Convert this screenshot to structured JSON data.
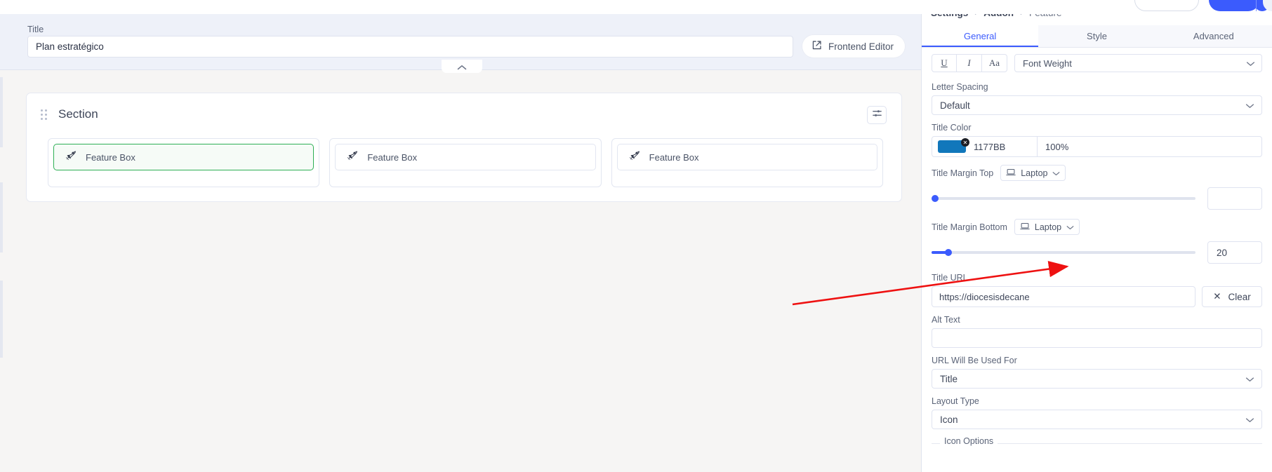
{
  "topbar": {
    "search_value": "",
    "primary_label": "",
    "avatar_label": ""
  },
  "canvas": {
    "title_label": "Title",
    "title_value": "Plan estratégico",
    "frontend_editor_label": "Frontend Editor",
    "frontend_editor_icon": "external-link-icon",
    "collapse_icon": "chevron-up-icon",
    "section": {
      "name": "Section",
      "drag_icon": "drag-handle-icon",
      "tool_icon": "section-settings-icon",
      "boxes": [
        {
          "label": "Feature Box",
          "icon": "rocket-icon",
          "selected": true
        },
        {
          "label": "Feature Box",
          "icon": "rocket-icon",
          "selected": false
        },
        {
          "label": "Feature Box",
          "icon": "rocket-icon",
          "selected": false
        }
      ]
    }
  },
  "panel": {
    "breadcrumb": [
      "Settings",
      "Addon",
      "Feature"
    ],
    "breadcrumb_separator": "›",
    "tabs": [
      {
        "label": "General",
        "active": true
      },
      {
        "label": "Style",
        "active": false
      },
      {
        "label": "Advanced",
        "active": false
      }
    ],
    "typography": {
      "underline_icon": "underline-icon",
      "underline_glyph": "U",
      "italic_icon": "italic-icon",
      "italic_glyph": "I",
      "text_transform_icon": "text-transform-icon",
      "text_transform_glyph": "Aa",
      "font_weight_label": "Font Weight",
      "chevron_icon": "chevron-down-icon"
    },
    "letter_spacing": {
      "label": "Letter Spacing",
      "value": "Default"
    },
    "title_color": {
      "label": "Title Color",
      "hex": "1177BB",
      "swatch": "#1177BB",
      "opacity": "100%",
      "reset_icon": "clear-color-icon",
      "reset_glyph": "✕"
    },
    "title_margin_top": {
      "label": "Title Margin Top",
      "device": "Laptop",
      "device_icon": "laptop-icon",
      "value": "",
      "slider_percent": 0
    },
    "title_margin_bottom": {
      "label": "Title Margin Bottom",
      "device": "Laptop",
      "device_icon": "laptop-icon",
      "value": "20",
      "slider_percent": 7
    },
    "title_url": {
      "label": "Title URL",
      "value": "https://diocesisdecane",
      "clear_label": "Clear",
      "clear_icon": "close-icon",
      "clear_glyph": "✕"
    },
    "alt_text": {
      "label": "Alt Text",
      "value": ""
    },
    "url_used_for": {
      "label": "URL Will Be Used For",
      "value": "Title"
    },
    "layout_type": {
      "label": "Layout Type",
      "value": "Icon"
    },
    "icon_options": {
      "label": "Icon Options"
    }
  },
  "annotation": {
    "arrow_color": "#ee1111",
    "arrow_name": "red-pointer-arrow"
  },
  "colors": {
    "accent": "#3b5bfd",
    "selected_green": "#2eaf55",
    "canvas_bg": "#f6f5f4",
    "titlebar_bg": "#eef1f9"
  }
}
